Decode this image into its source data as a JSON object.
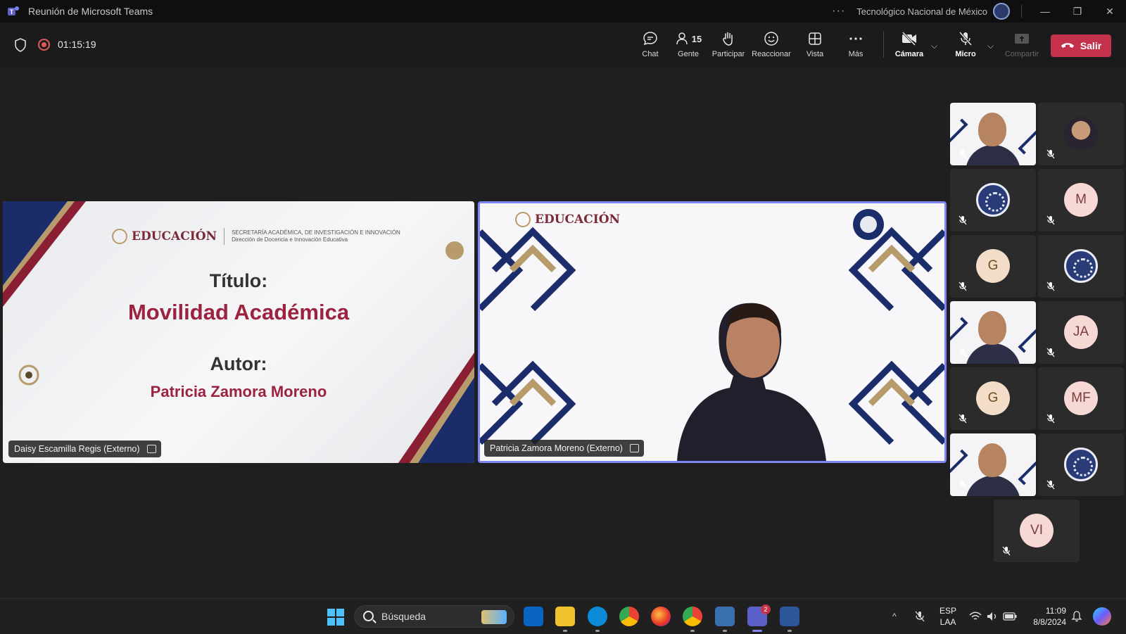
{
  "window": {
    "title": "Reunión de Microsoft Teams",
    "org_name": "Tecnológico Nacional de México",
    "more_glyph": "···",
    "minimize_glyph": "—",
    "restore_glyph": "❐",
    "close_glyph": "✕"
  },
  "meeting": {
    "timer": "01:15:19",
    "people_count": "15",
    "buttons": {
      "chat": "Chat",
      "people": "Gente",
      "raise": "Participar",
      "react": "Reaccionar",
      "view": "Vista",
      "more": "Más",
      "camera": "Cámara",
      "mic": "Micro",
      "share": "Compartir",
      "leave": "Salir"
    },
    "caret_glyph": "⌵"
  },
  "stage": {
    "left_tile": {
      "name_tag": "Daisy Escamilla Regis (Externo)",
      "slide": {
        "logo_word": "EDUCACIÓN",
        "logo_sub_1": "SECRETARÍA ACADÉMICA, DE INVESTIGACIÓN E INNOVACIÓN",
        "logo_sub_2": "Dirección de Docencia e Innovación Educativa",
        "title_label": "Título:",
        "title": "Movilidad Académica",
        "author_label": "Autor:",
        "author": "Patricia Zamora Moreno"
      }
    },
    "right_tile": {
      "name_tag": "Patricia Zamora Moreno (Externo)",
      "logo_word": "EDUCACIÓN"
    }
  },
  "participants": [
    {
      "type": "video",
      "initials": ""
    },
    {
      "type": "photo",
      "initials": ""
    },
    {
      "type": "logo",
      "initials": ""
    },
    {
      "type": "initials",
      "initials": "M"
    },
    {
      "type": "initials",
      "initials": "G"
    },
    {
      "type": "logo",
      "initials": ""
    },
    {
      "type": "video",
      "initials": ""
    },
    {
      "type": "initials",
      "initials": "JA"
    },
    {
      "type": "initials",
      "initials": "G"
    },
    {
      "type": "initials",
      "initials": "MF"
    },
    {
      "type": "video",
      "initials": ""
    },
    {
      "type": "logo",
      "initials": ""
    },
    {
      "type": "initials",
      "initials": "VI"
    }
  ],
  "taskbar": {
    "search_placeholder": "Búsqueda",
    "teams_badge": "2",
    "lang_1": "ESP",
    "lang_2": "LAA",
    "time": "11:09",
    "date": "8/8/2024",
    "tray_up_glyph": "^"
  },
  "colors": {
    "leave": "#c4314b",
    "active_border": "#7f85f5",
    "slide_accent": "#9b2340",
    "navy": "#1b2c6b",
    "gold": "#b79b6b"
  }
}
